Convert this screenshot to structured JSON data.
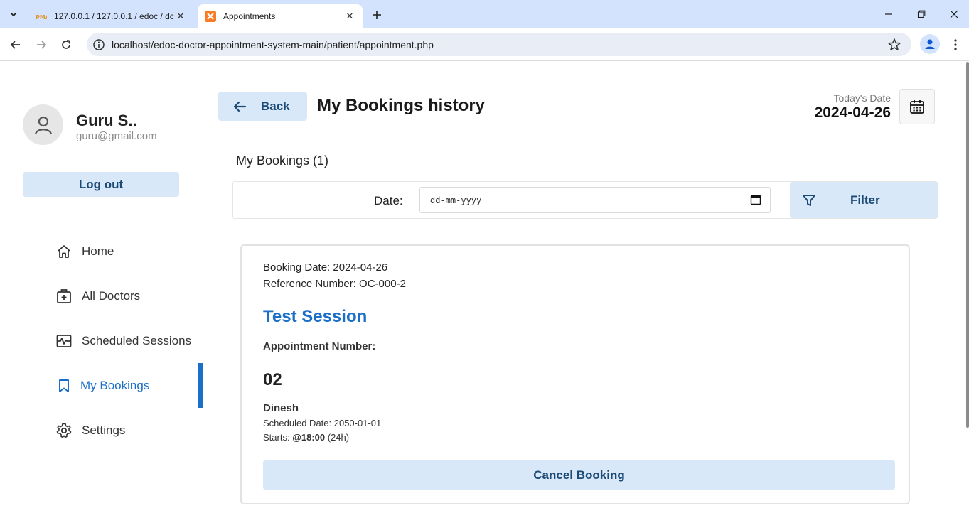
{
  "browser": {
    "tabs": [
      {
        "title": "127.0.0.1 / 127.0.0.1 / edoc / dc",
        "icon": "phpmyadmin-icon",
        "active": false
      },
      {
        "title": "Appointments",
        "icon": "xampp-icon",
        "active": true
      }
    ],
    "url": "localhost/edoc-doctor-appointment-system-main/patient/appointment.php"
  },
  "sidebar": {
    "user_name": "Guru S..",
    "user_email": "guru@gmail.com",
    "logout_label": "Log out",
    "items": [
      {
        "label": "Home",
        "icon": "home-icon"
      },
      {
        "label": "All Doctors",
        "icon": "doctors-icon"
      },
      {
        "label": "Scheduled Sessions",
        "icon": "sessions-icon"
      },
      {
        "label": "My Bookings",
        "icon": "bookmark-icon",
        "active": true
      },
      {
        "label": "Settings",
        "icon": "gear-icon"
      }
    ]
  },
  "header": {
    "back_label": "Back",
    "title": "My Bookings history",
    "today_label": "Today's Date",
    "today_value": "2024-04-26"
  },
  "filter": {
    "section_title": "My Bookings (1)",
    "date_label": "Date:",
    "date_placeholder": "dd-mm-yyyy",
    "filter_label": "Filter"
  },
  "booking": {
    "booking_date": "Booking Date: 2024-04-26",
    "reference": "Reference Number: OC-000-2",
    "session_title": "Test Session",
    "appointment_label": "Appointment Number:",
    "appointment_number": "02",
    "doctor": "Dinesh",
    "scheduled": "Scheduled Date: 2050-01-01",
    "starts_prefix": "Starts: ",
    "starts_time": "@18:00",
    "starts_suffix": " (24h)",
    "cancel_label": "Cancel Booking"
  },
  "colors": {
    "accent": "#1a6fc8",
    "button_bg": "#d8e8f8",
    "button_text": "#1c4a77",
    "chrome_bg": "#d3e3fd"
  }
}
